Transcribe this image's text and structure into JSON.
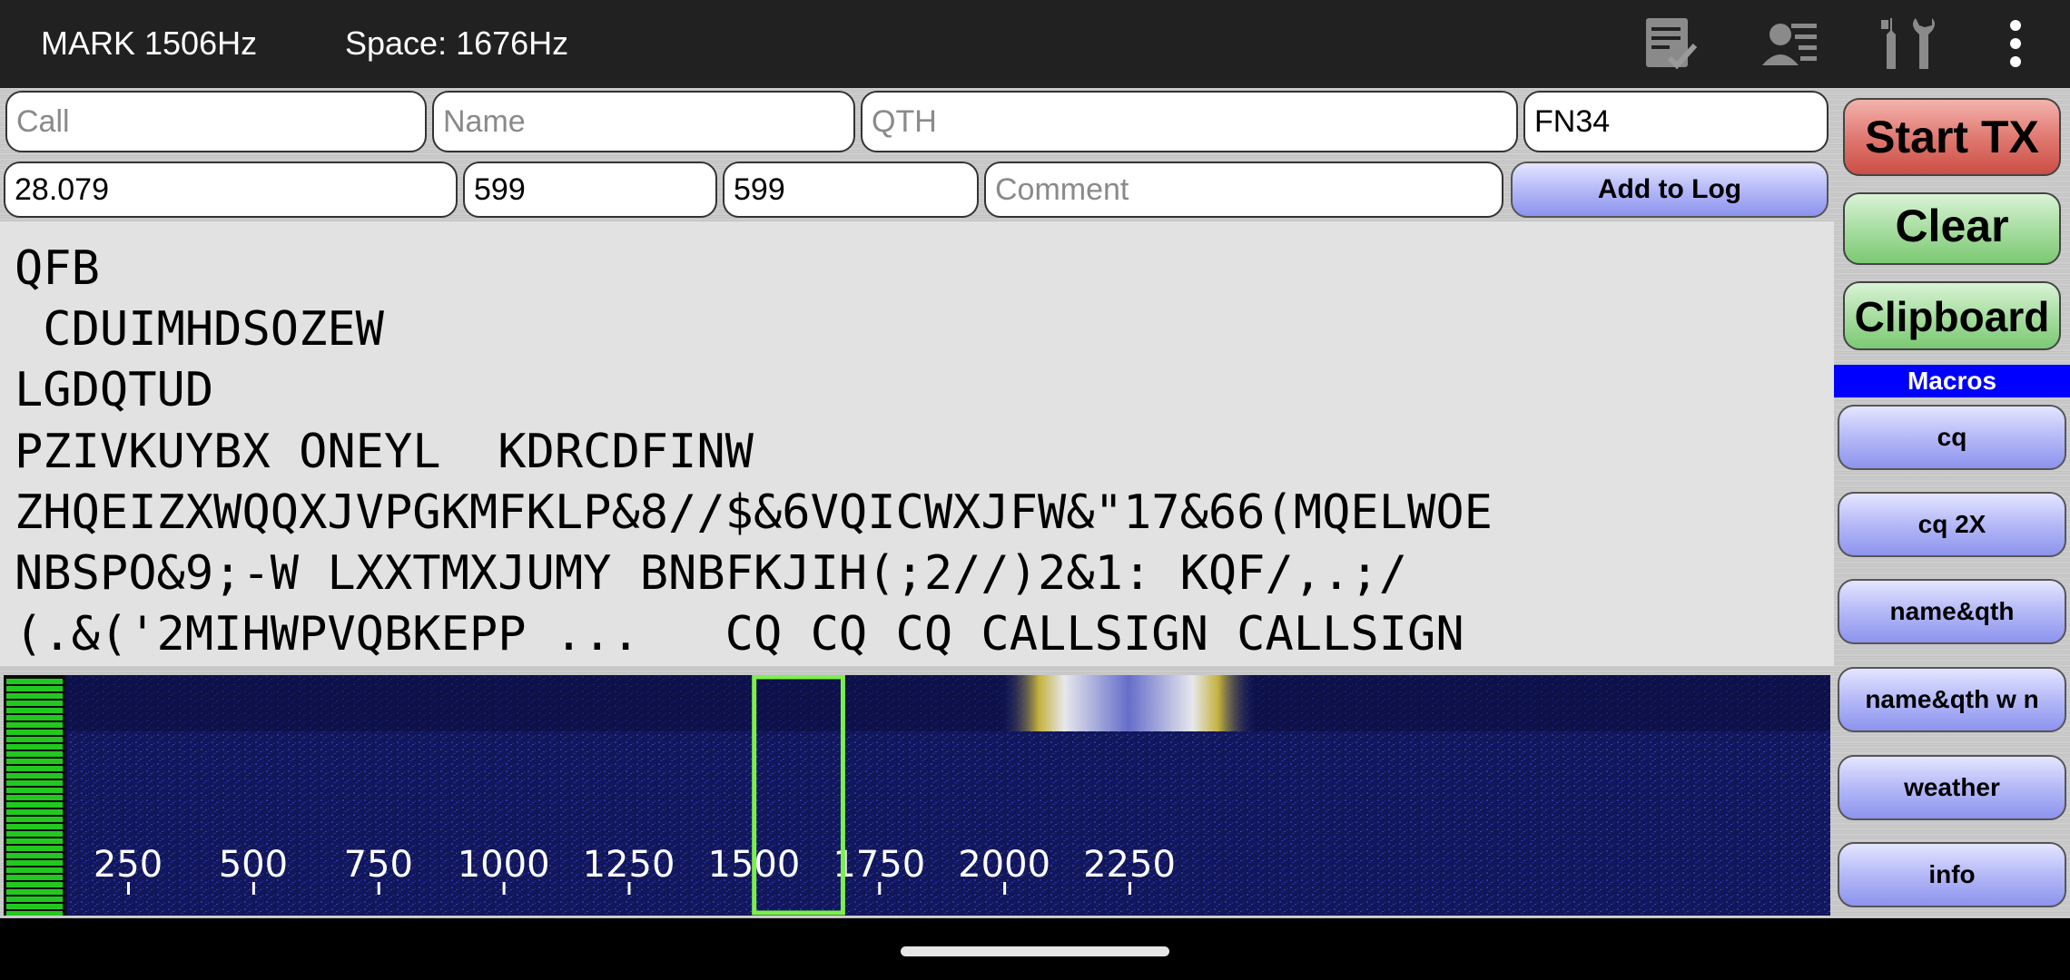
{
  "status": {
    "mark": "MARK 1506Hz",
    "space": "Space: 1676Hz"
  },
  "toolbar_icons": [
    "log-check-icon",
    "contact-list-icon",
    "tools-icon",
    "overflow-menu-icon"
  ],
  "fields": {
    "call": {
      "value": "",
      "placeholder": "Call"
    },
    "name": {
      "value": "",
      "placeholder": "Name"
    },
    "qth": {
      "value": "",
      "placeholder": "QTH"
    },
    "grid": {
      "value": "FN34",
      "placeholder": ""
    },
    "freq": {
      "value": "28.079",
      "placeholder": ""
    },
    "rst_sent": {
      "value": "599",
      "placeholder": ""
    },
    "rst_rcvd": {
      "value": "599",
      "placeholder": ""
    },
    "comment": {
      "value": "",
      "placeholder": "Comment"
    }
  },
  "buttons": {
    "add_to_log": "Add to Log",
    "start_tx": "Start TX",
    "clear": "Clear",
    "clipboard": "Clipboard"
  },
  "macros": {
    "header": "Macros",
    "items": [
      "cq",
      "cq 2X",
      "name&qth",
      "name&qth w n",
      "weather",
      "info"
    ]
  },
  "rx_text": [
    "QFB",
    " CDUIMHDSOZEW",
    "LGDQTUD",
    "PZIVKUYBX ONEYL  KDRCDFINW",
    "ZHQEIZXWQQXJVPGKMFKLP&8//$&6VQICWXJFW&\"17&66(MQELWOE",
    "NBSPO&9;-W LXXTMXJUMY BNBFKJIH(;2//)2&1: KQF/,.;/",
    "(.&('2MIHWPVQBKEPP ...   CQ CQ CQ CALLSIGN CALLSIGN"
  ],
  "waterfall": {
    "freq_labels": [
      "250",
      "500",
      "750",
      "1000",
      "1250",
      "1500",
      "1750",
      "2000",
      "2250"
    ],
    "freq_values_hz": [
      250,
      500,
      750,
      1000,
      1250,
      1500,
      1750,
      2000,
      2250
    ],
    "mark_hz": 1506,
    "space_hz": 1676,
    "colors": {
      "background": "#0c0f45",
      "marker": "#7cf04a",
      "level": "#22c81e"
    }
  }
}
